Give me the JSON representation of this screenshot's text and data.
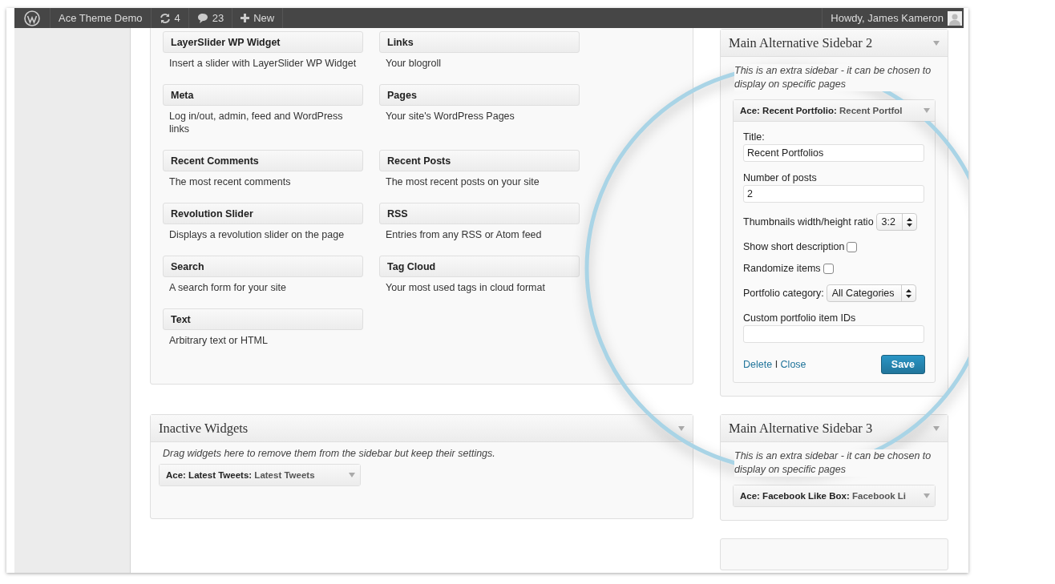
{
  "admin_bar": {
    "site": "Ace Theme Demo",
    "updates": "4",
    "comments": "23",
    "new": "New",
    "greeting": "Howdy, James Kameron"
  },
  "available_widgets": [
    {
      "title": "LayerSlider WP Widget",
      "description": "Insert a slider with LayerSlider WP Widget"
    },
    {
      "title": "Links",
      "description": "Your blogroll"
    },
    {
      "title": "Meta",
      "description": "Log in/out, admin, feed and WordPress links"
    },
    {
      "title": "Pages",
      "description": "Your site's WordPress Pages"
    },
    {
      "title": "Recent Comments",
      "description": "The most recent comments"
    },
    {
      "title": "Recent Posts",
      "description": "The most recent posts on your site"
    },
    {
      "title": "Revolution Slider",
      "description": "Displays a revolution slider on the page"
    },
    {
      "title": "RSS",
      "description": "Entries from any RSS or Atom feed"
    },
    {
      "title": "Search",
      "description": "A search form for your site"
    },
    {
      "title": "Tag Cloud",
      "description": "Your most used tags in cloud format"
    },
    {
      "title": "Text",
      "description": "Arbitrary text or HTML"
    }
  ],
  "inactive": {
    "title": "Inactive Widgets",
    "description": "Drag widgets here to remove them from the sidebar but keep their settings.",
    "widgets": [
      {
        "name": "Ace: Latest Tweets:",
        "title": "Latest Tweets",
        "expanded": false
      }
    ]
  },
  "sidebars": [
    {
      "title": "Main Alternative Sidebar 2",
      "description": "This is an extra sidebar - it can be chosen to display on specific pages",
      "widgets": [
        {
          "name": "Ace: Recent Portfolio:",
          "title": "Recent Portfol",
          "expanded": true,
          "fields": [
            {
              "kind": "text",
              "label": "Title:",
              "value": "Recent Portfolios"
            },
            {
              "kind": "text",
              "label": "Number of posts",
              "value": "2"
            },
            {
              "kind": "select",
              "label": "Thumbnails width/height ratio",
              "value": "3:2"
            },
            {
              "kind": "checkbox",
              "label": "Show short description",
              "checked": false
            },
            {
              "kind": "checkbox",
              "label": "Randomize items",
              "checked": false
            },
            {
              "kind": "select",
              "label": "Portfolio category:",
              "value": "All Categories"
            },
            {
              "kind": "text",
              "label": "Custom portfolio item IDs"
            }
          ],
          "actions": {
            "delete": "Delete",
            "separator": "I",
            "close": "Close",
            "save": "Save"
          }
        }
      ]
    },
    {
      "title": "Main Alternative Sidebar 3",
      "description": "This is an extra sidebar - it can be chosen to display on specific pages",
      "widgets": [
        {
          "name": "Ace: Facebook Like Box:",
          "title": "Facebook Li",
          "expanded": false
        }
      ]
    }
  ]
}
